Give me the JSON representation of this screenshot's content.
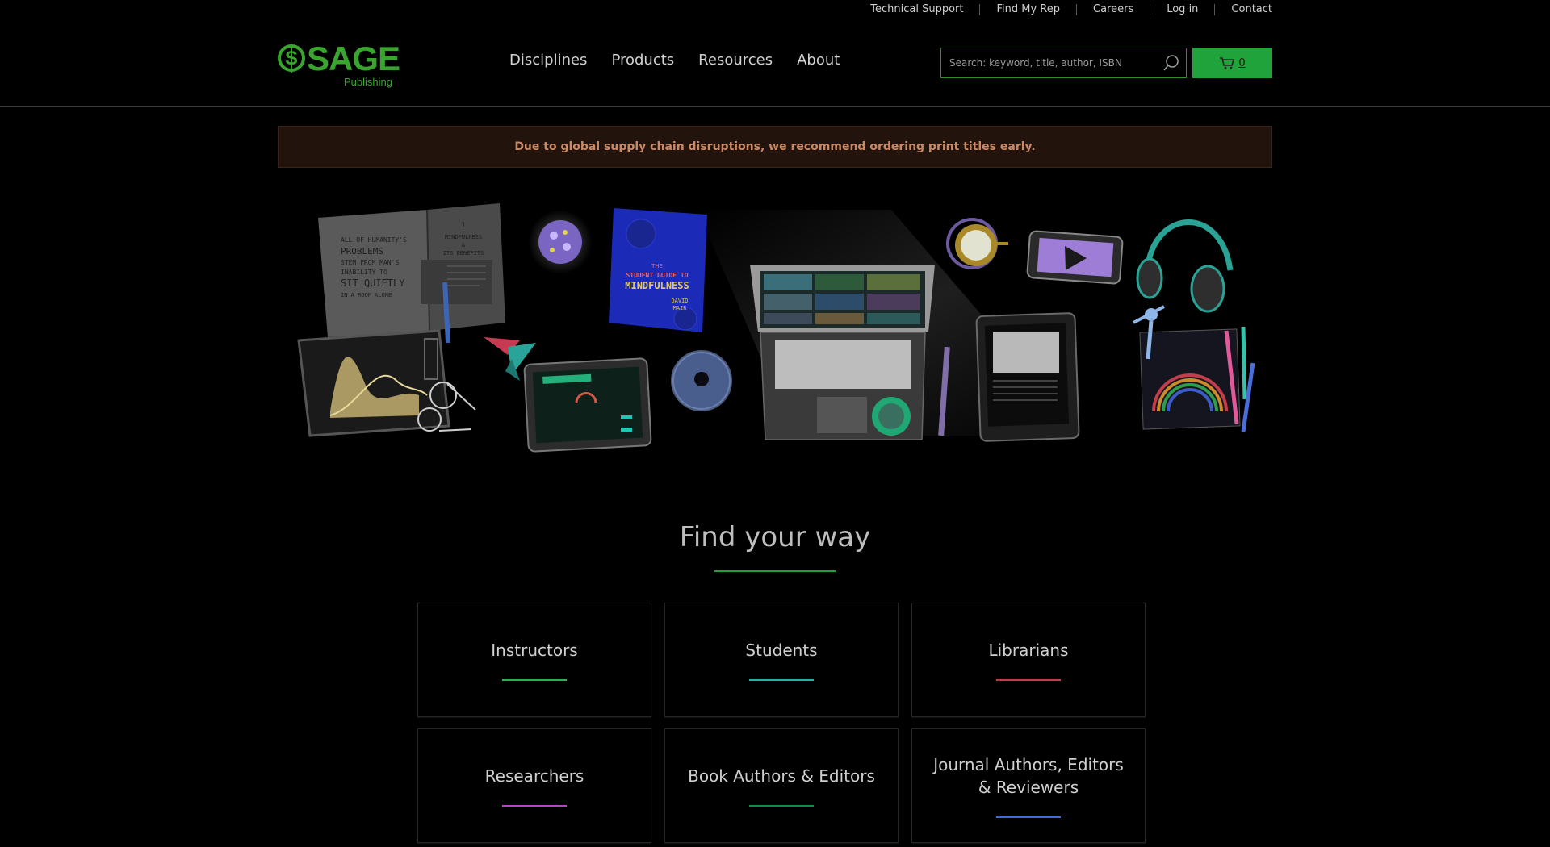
{
  "utility_nav": [
    "Technical Support",
    "Find My Rep",
    "Careers",
    "Log in",
    "Contact"
  ],
  "logo": {
    "main": "SAGE",
    "sub": "Publishing",
    "color": "#3aa52e"
  },
  "main_nav": [
    "Disciplines",
    "Products",
    "Resources",
    "About"
  ],
  "search": {
    "placeholder": "Search: keyword, title, author, ISBN"
  },
  "cart": {
    "count": "0",
    "color": "#20a33a"
  },
  "alert": {
    "text": "Due to global supply chain disruptions, we recommend ordering print titles early."
  },
  "hero": {
    "book_left_lines": [
      "ALL OF HUMANITY'S",
      "PROBLEMS",
      "STEM FROM MAN'S",
      "INABILITY TO",
      "SIT QUIETLY",
      "IN A ROOM ALONE"
    ],
    "book_right_title": [
      "1",
      "MINDFULNESS",
      "&",
      "ITS BENEFITS"
    ],
    "book_blue": {
      "small": "THE",
      "line1": "STUDENT GUIDE TO",
      "line2": "MINDFULNESS",
      "author1": "DAVID",
      "author2": "MAIR"
    }
  },
  "find_your_way": {
    "title": "Find your way",
    "cards": [
      {
        "label": "Instructors",
        "color": "#2bb24c"
      },
      {
        "label": "Students",
        "color": "#22b3a5"
      },
      {
        "label": "Librarians",
        "color": "#c43b4a"
      },
      {
        "label": "Researchers",
        "color": "#b145c3"
      },
      {
        "label": "Book Authors & Editors",
        "color": "#148a4e"
      },
      {
        "label": "Journal Authors, Editors & Reviewers",
        "color": "#3c6ddc"
      }
    ]
  }
}
